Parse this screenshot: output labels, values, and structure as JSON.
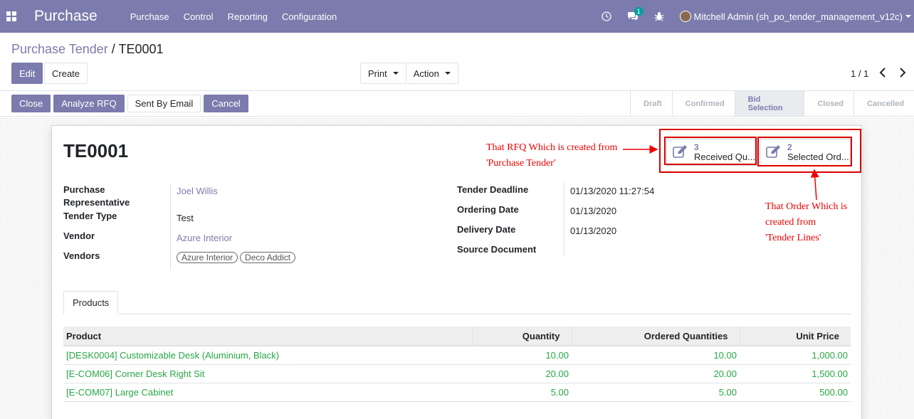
{
  "navbar": {
    "brand": "Purchase",
    "menu": [
      "Purchase",
      "Control",
      "Reporting",
      "Configuration"
    ],
    "messages_count": "1",
    "user": "Mitchell Admin (sh_po_tender_management_v12c)",
    "bg_color": "#7c7bad"
  },
  "breadcrumb": {
    "parent": "Purchase Tender",
    "separator": " / ",
    "current": "TE0001"
  },
  "buttons": {
    "edit": "Edit",
    "create": "Create",
    "print": "Print",
    "action": "Action"
  },
  "pager": "1 / 1",
  "status_buttons": [
    "Close",
    "Analyze RFQ",
    "Sent By Email",
    "Cancel"
  ],
  "stages": [
    {
      "label": "Draft",
      "active": false
    },
    {
      "label": "Confirmed",
      "active": false
    },
    {
      "label": "Bid Selection",
      "active": true
    },
    {
      "label": "Closed",
      "active": false
    },
    {
      "label": "Cancelled",
      "active": false
    }
  ],
  "record": {
    "name": "TE0001",
    "smart_buttons": [
      {
        "value": "3",
        "label": "Received Qu..."
      },
      {
        "value": "2",
        "label": "Selected Ord..."
      }
    ],
    "left_fields": {
      "purchase_rep_label_1": "Purchase",
      "purchase_rep_label_2": "Representative",
      "purchase_rep": "Joel Willis",
      "tender_type_label": "Tender Type",
      "tender_type": "Test",
      "vendor_label": "Vendor",
      "vendor": "Azure Interior",
      "vendors_label": "Vendors",
      "vendors": [
        "Azure Interior",
        "Deco Addict"
      ]
    },
    "right_fields": {
      "deadline_label": "Tender Deadline",
      "deadline": "01/13/2020 11:27:54",
      "ordering_label": "Ordering Date",
      "ordering": "01/13/2020",
      "delivery_label": "Delivery Date",
      "delivery": "01/13/2020",
      "source_label": "Source Document",
      "source": ""
    },
    "tab": "Products",
    "columns": [
      "Product",
      "Quantity",
      "Ordered Quantities",
      "Unit Price"
    ],
    "rows": [
      {
        "product": "[DESK0004] Customizable Desk (Aluminium, Black)",
        "qty": "10.00",
        "ordered": "10.00",
        "price": "1,000.00"
      },
      {
        "product": "[E-COM06] Corner Desk Right Sit",
        "qty": "20.00",
        "ordered": "20.00",
        "price": "1,500.00"
      },
      {
        "product": "[E-COM07] Large Cabinet",
        "qty": "5.00",
        "ordered": "5.00",
        "price": "500.00"
      }
    ]
  },
  "annotations": {
    "rfq_line1": "That RFQ Which is created from",
    "rfq_line2": "'Purchase Tender'",
    "order_line1": "That Order Which is created from",
    "order_line2": "'Tender Lines'"
  }
}
